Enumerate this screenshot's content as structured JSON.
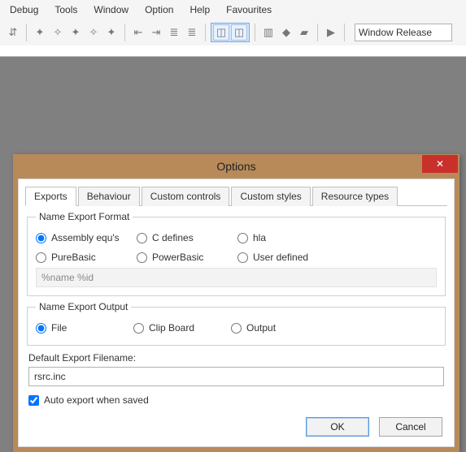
{
  "menu": {
    "items": [
      "Debug",
      "Tools",
      "Window",
      "Option",
      "Help",
      "Favourites"
    ]
  },
  "toolbar": {
    "combo_value": "Window Release"
  },
  "dialog": {
    "title": "Options",
    "close_glyph": "✕",
    "tabs": [
      "Exports",
      "Behaviour",
      "Custom controls",
      "Custom styles",
      "Resource types"
    ],
    "active_tab_index": 0,
    "name_export_format": {
      "legend": "Name Export Format",
      "options": [
        "Assembly equ's",
        "C defines",
        "hla",
        "PureBasic",
        "PowerBasic",
        "User defined"
      ],
      "selected_index": 0,
      "pattern_field": "%name %id"
    },
    "name_export_output": {
      "legend": "Name Export Output",
      "options": [
        "File",
        "Clip Board",
        "Output"
      ],
      "selected_index": 0
    },
    "default_filename_label": "Default Export Filename:",
    "default_filename_value": "rsrc.inc",
    "auto_export_label": "Auto export when saved",
    "auto_export_checked": true,
    "ok_label": "OK",
    "cancel_label": "Cancel"
  }
}
